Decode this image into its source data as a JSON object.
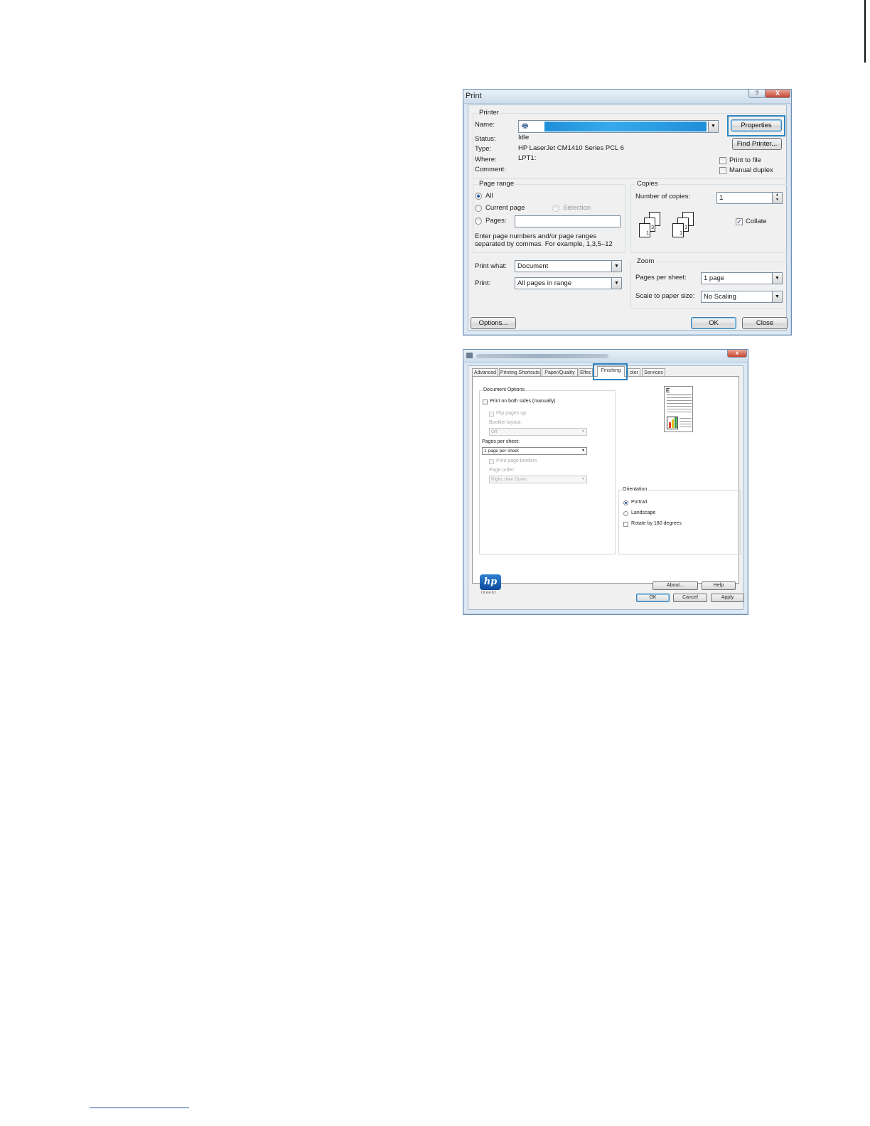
{
  "print_dialog": {
    "title": "Print",
    "help_glyph": "?",
    "close_glyph": "X",
    "printer": {
      "group_label": "Printer",
      "name_label": "Name:",
      "status_label": "Status:",
      "status_value": "Idle",
      "type_label": "Type:",
      "type_value": "HP LaserJet CM1410 Series PCL 6",
      "where_label": "Where:",
      "where_value": "LPT1:",
      "comment_label": "Comment:",
      "properties_button": "Properties",
      "find_printer_button": "Find Printer...",
      "print_to_file_label": "Print to file",
      "manual_duplex_label": "Manual duplex",
      "icon": "printer-icon"
    },
    "page_range": {
      "group_label": "Page range",
      "all_label": "All",
      "current_page_label": "Current page",
      "selection_label": "Selection",
      "pages_label": "Pages:",
      "pages_value": "",
      "hint_line1": "Enter page numbers and/or page ranges",
      "hint_line2": "separated by commas.  For example, 1,3,5–12"
    },
    "copies": {
      "group_label": "Copies",
      "number_label": "Number of copies:",
      "number_value": "1",
      "collate_label": "Collate",
      "collate_checked": true,
      "page_numbers": [
        "1",
        "2",
        "3"
      ]
    },
    "print_what_label": "Print what:",
    "print_what_value": "Document",
    "print_label": "Print:",
    "print_value": "All pages in range",
    "zoom": {
      "group_label": "Zoom",
      "pages_per_sheet_label": "Pages per sheet:",
      "pages_per_sheet_value": "1 page",
      "scale_label": "Scale to paper size:",
      "scale_value": "No Scaling"
    },
    "options_button": "Options...",
    "ok_button": "OK",
    "close_button": "Close",
    "selection_color": "#1e8fd8",
    "highlight_color": "#2e86c1"
  },
  "properties_dialog": {
    "close_glyph": "x",
    "tabs": [
      "Advanced",
      "Printing Shortcuts",
      "Paper/Quality",
      "Effec",
      "Finishing",
      "olor",
      "Services"
    ],
    "active_tab": "Finishing",
    "document_options": {
      "group_label": "Document Options",
      "print_both_sides_label": "Print on both sides (manually)",
      "flip_pages_up_label": "Flip pages up",
      "booklet_layout_label": "Booklet layout:",
      "booklet_layout_value": "Off",
      "pages_per_sheet_label": "Pages per sheet:",
      "pages_per_sheet_value": "1 page per sheet",
      "print_page_borders_label": "Print page borders",
      "page_order_label": "Page order:",
      "page_order_value": "Right, then Down"
    },
    "orientation": {
      "group_label": "Orientation",
      "portrait_label": "Portrait",
      "landscape_label": "Landscape",
      "rotate_label": "Rotate by 180 degrees"
    },
    "preview_letter": "E",
    "logo_text": "hp",
    "logo_tagline": "i n v e n t",
    "about_button": "About...",
    "help_button": "Help",
    "ok_button": "OK",
    "cancel_button": "Cancel",
    "apply_button": "Apply"
  }
}
